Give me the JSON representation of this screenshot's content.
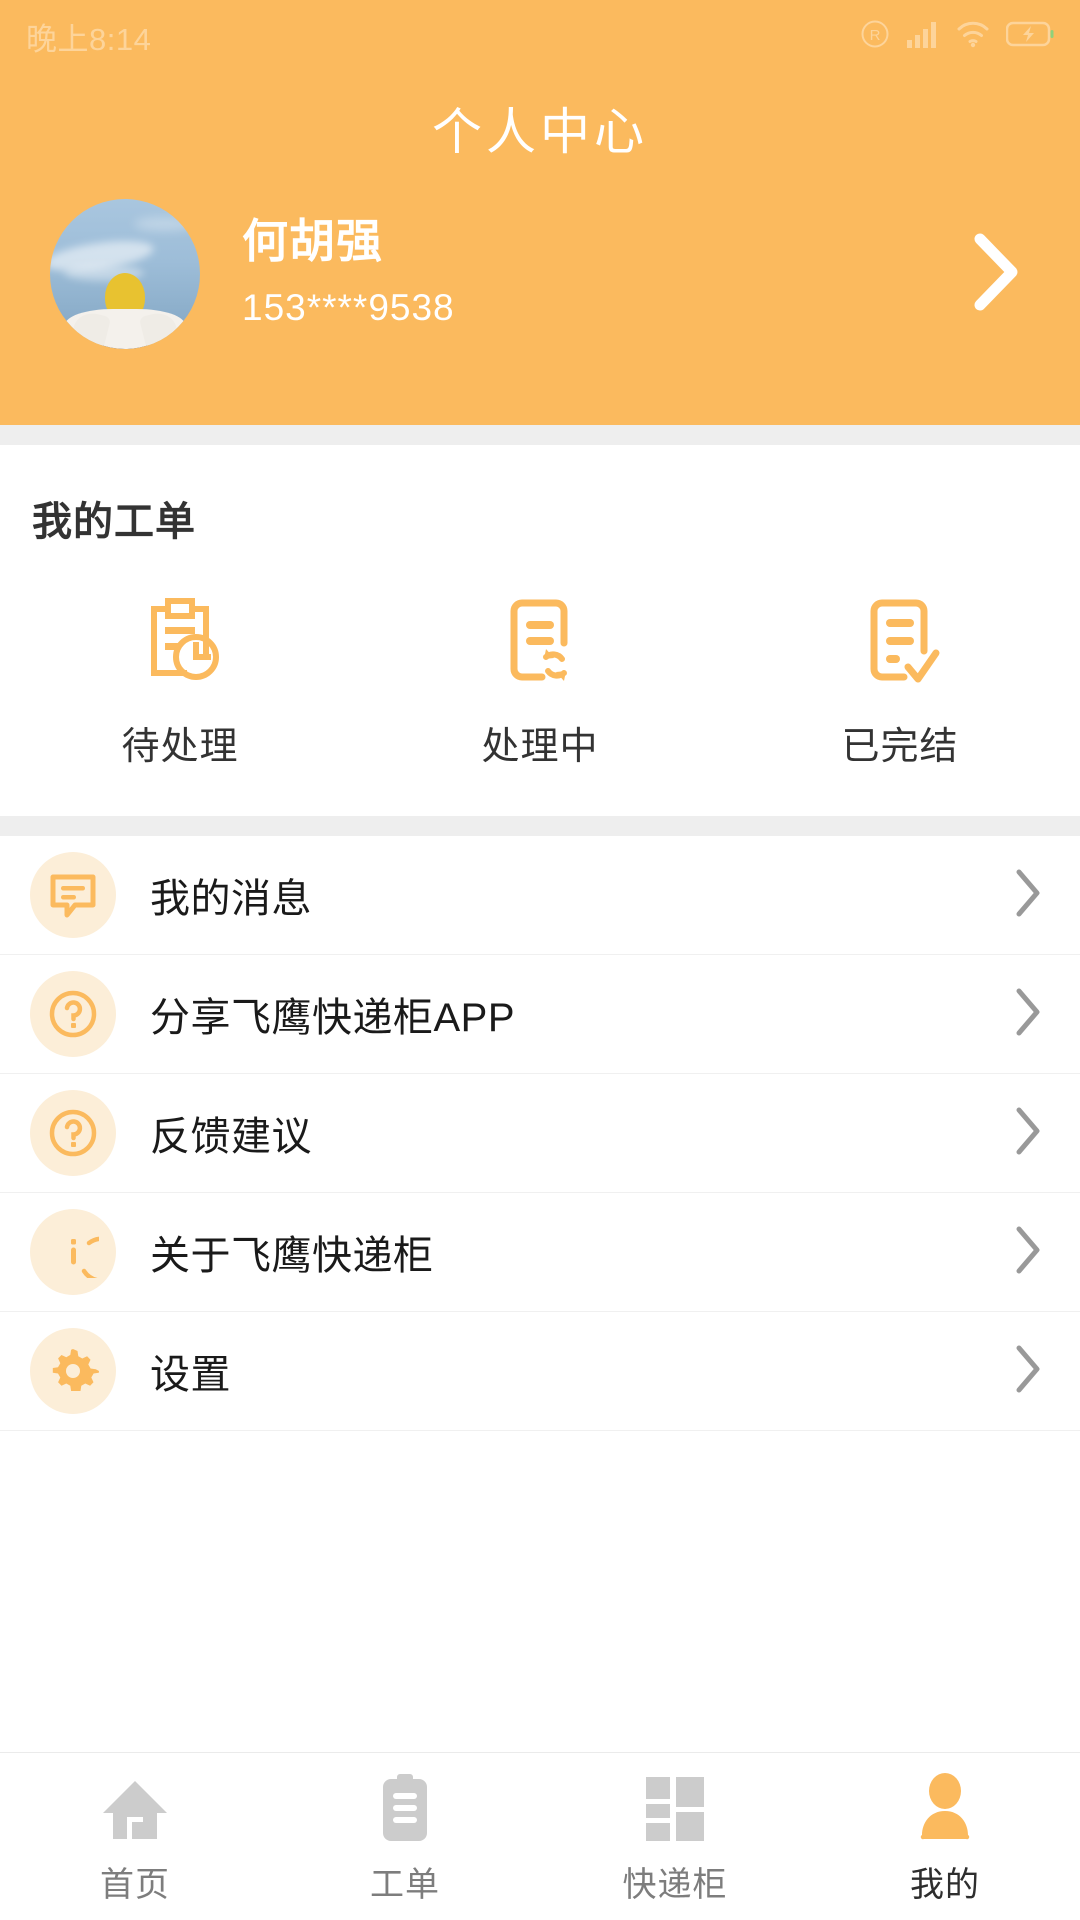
{
  "status_bar": {
    "time": "晚上8:14",
    "icons": [
      "roaming-icon",
      "signal-icon",
      "wifi-icon",
      "battery-charging-icon"
    ]
  },
  "header": {
    "title": "个人中心",
    "background_color": "#fbba5e",
    "profile": {
      "name": "何胡强",
      "phone": "153****9538",
      "avatar_alt": "avatar-photo",
      "chevron": "chevron-right-icon"
    }
  },
  "work_orders": {
    "section_title": "我的工单",
    "items": [
      {
        "label": "待处理",
        "icon": "clipboard-clock-icon"
      },
      {
        "label": "处理中",
        "icon": "document-refresh-icon"
      },
      {
        "label": "已完结",
        "icon": "document-check-icon"
      }
    ]
  },
  "menu": {
    "items": [
      {
        "label": "我的消息",
        "icon": "chat-bubble-icon"
      },
      {
        "label": "分享飞鹰快递柜APP",
        "icon": "question-mark-icon"
      },
      {
        "label": "反馈建议",
        "icon": "question-mark-icon"
      },
      {
        "label": "关于飞鹰快递柜",
        "icon": "info-icon"
      },
      {
        "label": "设置",
        "icon": "gear-icon"
      }
    ]
  },
  "tabbar": {
    "items": [
      {
        "label": "首页",
        "icon": "home-icon",
        "active": false
      },
      {
        "label": "工单",
        "icon": "clipboard-icon",
        "active": false
      },
      {
        "label": "快递柜",
        "icon": "locker-grid-icon",
        "active": false
      },
      {
        "label": "我的",
        "icon": "person-icon",
        "active": true
      }
    ]
  },
  "colors": {
    "accent": "#fbba5e",
    "icon_orange": "#fbba5e",
    "badge_bg": "#fceed8",
    "text_primary": "#1a1a1a",
    "tab_inactive": "#cccccc",
    "page_bg": "#eeeeee"
  }
}
